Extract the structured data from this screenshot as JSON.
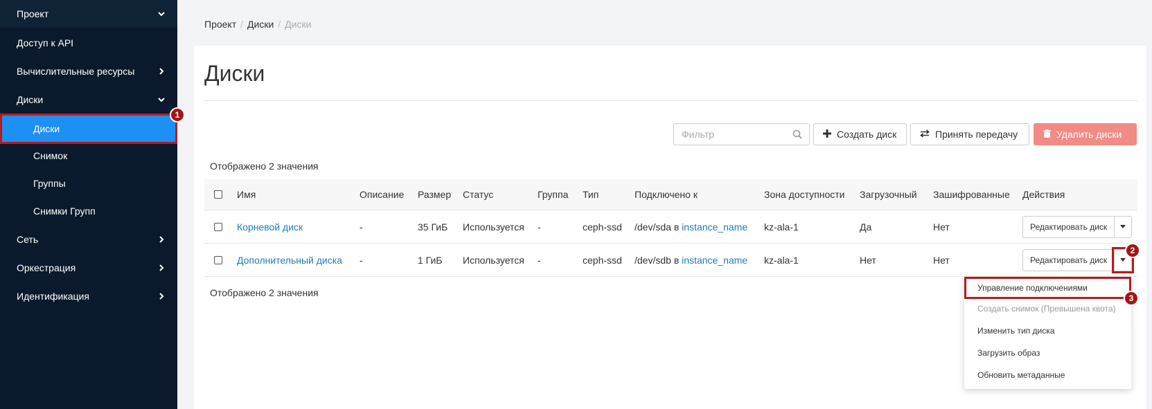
{
  "sidebar": {
    "items": [
      {
        "label": "Проект"
      },
      {
        "label": "Доступ к API"
      },
      {
        "label": "Вычислительные ресурсы"
      },
      {
        "label": "Диски"
      },
      {
        "label": "Диски"
      },
      {
        "label": "Снимок"
      },
      {
        "label": "Группы"
      },
      {
        "label": "Снимки Групп"
      },
      {
        "label": "Сеть"
      },
      {
        "label": "Оркестрация"
      },
      {
        "label": "Идентификация"
      }
    ]
  },
  "breadcrumb": {
    "items": [
      "Проект",
      "Диски",
      "Диски"
    ],
    "separator": "/"
  },
  "page": {
    "title": "Диски"
  },
  "toolbar": {
    "filter_placeholder": "Фильтр",
    "create_label": "Создать диск",
    "accept_label": "Принять передачу",
    "delete_label": "Удалить диски"
  },
  "table": {
    "count_text": "Отображено 2 значения",
    "columns": [
      "Имя",
      "Описание",
      "Размер",
      "Статус",
      "Группа",
      "Тип",
      "Подключено к",
      "Зона доступности",
      "Загрузочный",
      "Зашифрованные",
      "Действия"
    ],
    "rows": [
      {
        "name": "Корневой диск",
        "description": "-",
        "size": "35 ГиБ",
        "status": "Используется",
        "group": "-",
        "type": "ceph-ssd",
        "attached_prefix": "/dev/sda в",
        "attached_link": "instance_name",
        "zone": "kz-ala-1",
        "bootable": "Да",
        "encrypted": "Нет",
        "action": "Редактировать диск"
      },
      {
        "name": "Дополнительный диска",
        "description": "-",
        "size": "1 ГиБ",
        "status": "Используется",
        "group": "-",
        "type": "ceph-ssd",
        "attached_prefix": "/dev/sdb в",
        "attached_link": "instance_name",
        "zone": "kz-ala-1",
        "bootable": "Нет",
        "encrypted": "Нет",
        "action": "Редактировать диск"
      }
    ]
  },
  "dropdown": {
    "items": [
      {
        "label": "Управление подключениями",
        "disabled": false
      },
      {
        "label": "Создать снимок (Превышена квота)",
        "disabled": true
      },
      {
        "label": "Изменить тип диска",
        "disabled": false
      },
      {
        "label": "Загрузить образ",
        "disabled": false
      },
      {
        "label": "Обновить метаданные",
        "disabled": false
      }
    ]
  },
  "annotations": {
    "badge1": "1",
    "badge2": "2",
    "badge3": "3"
  },
  "colors": {
    "sidebar_bg": "#0a1a2c",
    "active": "#1e8ff3",
    "link": "#1f7ab9",
    "danger": "#f28b85",
    "highlight": "#b71c1c"
  }
}
